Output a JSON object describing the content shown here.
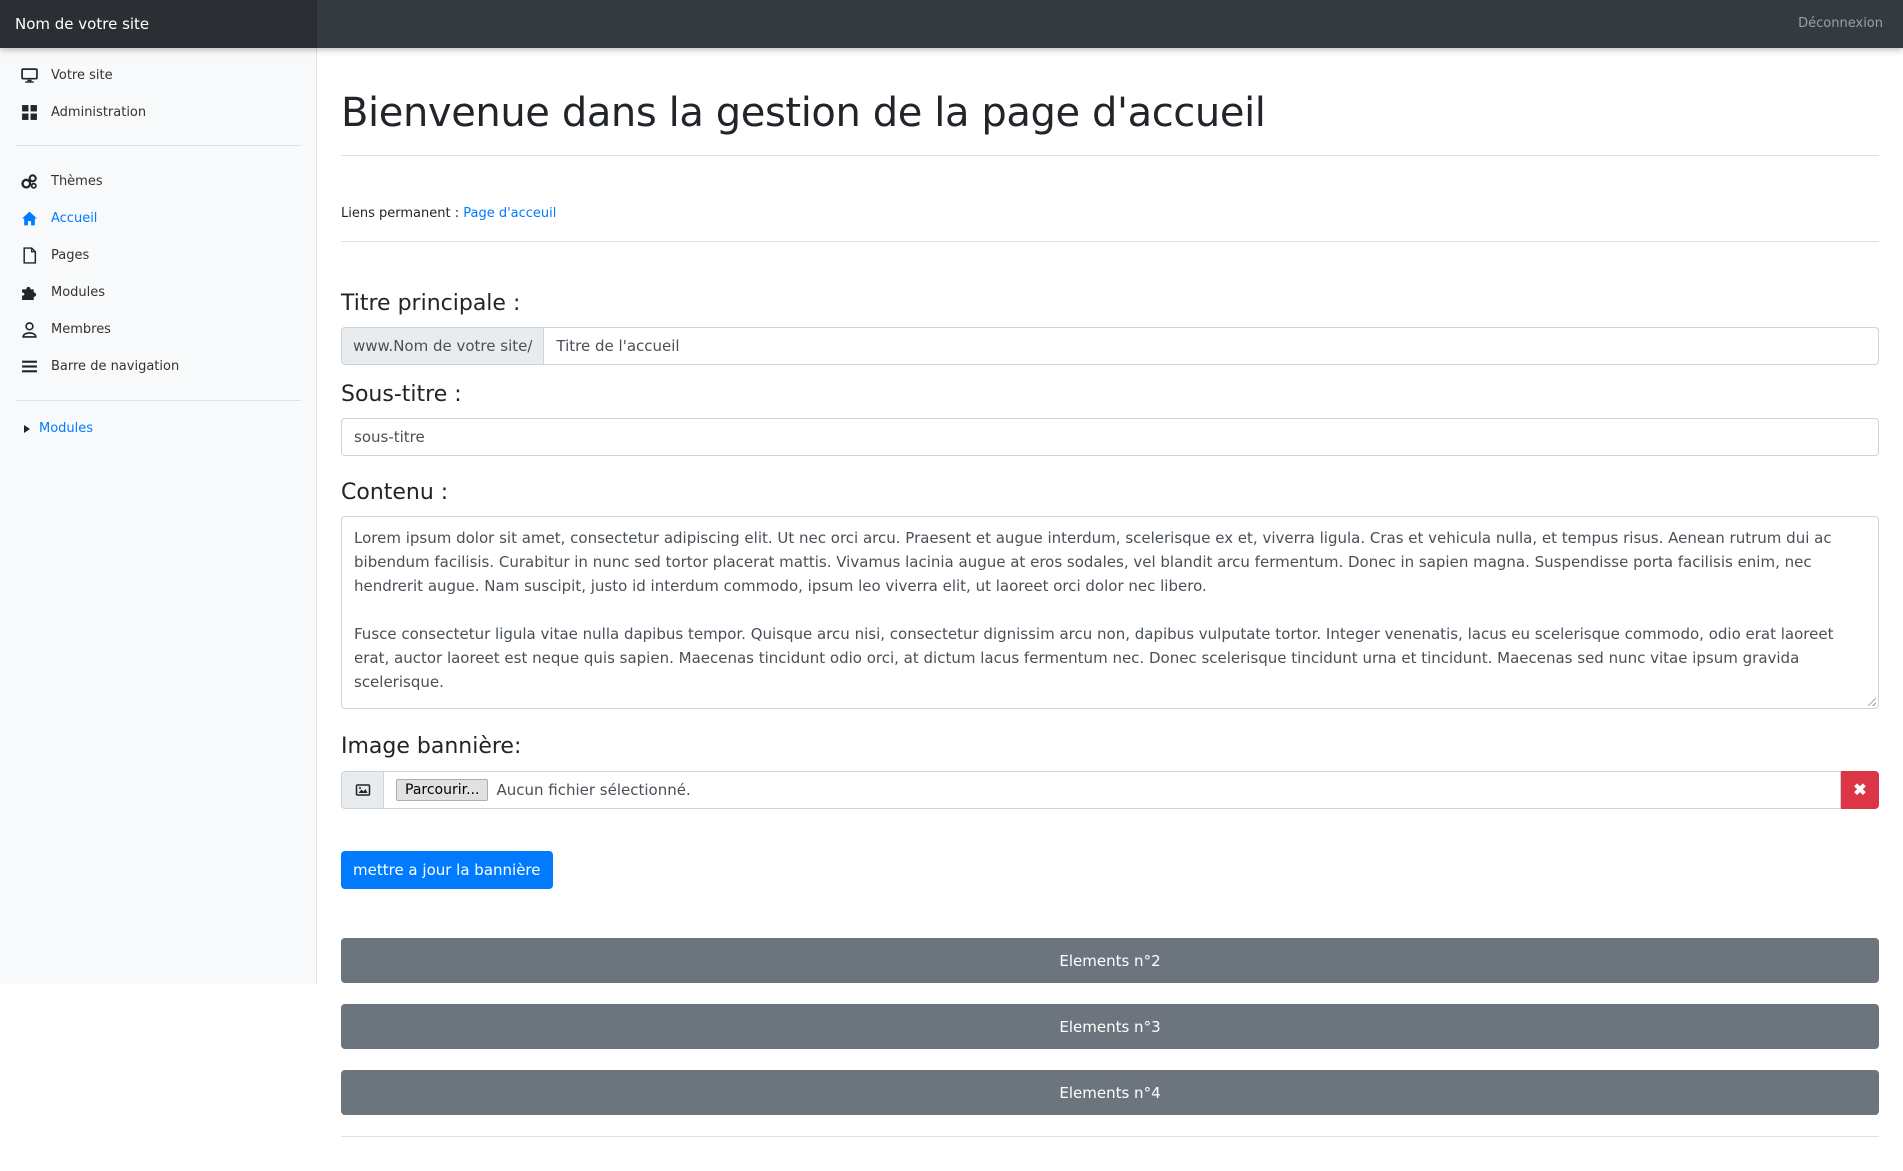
{
  "topbar": {
    "brand": "Nom de votre site",
    "logout_label": "Déconnexion"
  },
  "sidebar": {
    "group1": [
      {
        "label": "Votre site",
        "icon": "monitor-icon"
      },
      {
        "label": "Administration",
        "icon": "dashboard-grid-icon"
      }
    ],
    "group2": [
      {
        "label": "Thèmes",
        "icon": "cogs-icon"
      },
      {
        "label": "Accueil",
        "icon": "home-icon",
        "active": true
      },
      {
        "label": "Pages",
        "icon": "file-icon"
      },
      {
        "label": "Modules",
        "icon": "puzzle-icon"
      },
      {
        "label": "Membres",
        "icon": "user-icon"
      },
      {
        "label": "Barre de navigation",
        "icon": "bars-icon"
      }
    ],
    "collapsible_label": "Modules"
  },
  "main": {
    "title": "Bienvenue dans la gestion de la page d'accueil",
    "permalink_prefix": "Liens permanent :",
    "permalink_link": "Page d'acceuil",
    "main_title_label": "Titre principale :",
    "main_title_addon": "www.Nom de votre site/",
    "main_title_value": "Titre de l'accueil",
    "subtitle_label": "Sous-titre :",
    "subtitle_value": "sous-titre",
    "content_label": "Contenu :",
    "content_paragraphs": [
      "Lorem ipsum dolor sit amet, consectetur adipiscing elit. Ut nec orci arcu. Praesent et augue interdum, scelerisque ex et, viverra ligula. Cras et vehicula nulla, et tempus risus. Aenean rutrum dui ac bibendum facilisis. Curabitur in nunc sed tortor placerat mattis. Vivamus lacinia augue at eros sodales, vel blandit arcu fermentum. Donec in sapien magna. Suspendisse porta facilisis enim, nec hendrerit augue. Nam suscipit, justo id interdum commodo, ipsum leo viverra elit, ut laoreet orci dolor nec libero.",
      "Fusce consectetur ligula vitae nulla dapibus tempor. Quisque arcu nisi, consectetur dignissim arcu non, dapibus vulputate tortor. Integer venenatis, lacus eu scelerisque commodo, odio erat laoreet erat, auctor laoreet est neque quis sapien. Maecenas tincidunt odio orci, at dictum lacus fermentum nec. Donec scelerisque tincidunt urna et tincidunt. Maecenas sed nunc vitae ipsum gravida scelerisque."
    ],
    "banner_label": "Image bannière:",
    "browse_label": "Parcourir...",
    "no_file_text": "Aucun fichier sélectionné.",
    "remove_symbol": "✖",
    "update_button": "mettre a jour la bannière",
    "element_buttons": [
      "Elements n°2",
      "Elements n°3",
      "Elements n°4"
    ]
  },
  "colors": {
    "primary": "#007bff",
    "danger": "#dc3545",
    "secondary": "#6c757d",
    "topbar": "#343a40"
  }
}
